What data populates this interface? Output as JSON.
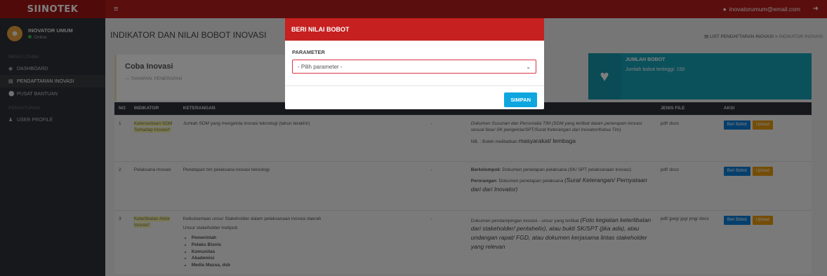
{
  "topbar": {
    "brand": "SIINOTEK",
    "hamburger_icon": "≡",
    "user_email": "inovatorumum@email.com",
    "logout_icon": "➜"
  },
  "sidebar": {
    "user_name": "INOVATOR UMUM",
    "user_status": "Online",
    "header_main": "MENU UTAMA",
    "items": [
      {
        "label": "DASHBOARD",
        "icon": "dashboard-icon"
      },
      {
        "label": "PENDAFTARAN INOVASI",
        "icon": "list-icon"
      },
      {
        "label": "PUSAT BANTUAN",
        "icon": "help-icon"
      }
    ],
    "header_settings": "PENGATURAN",
    "settings_items": [
      {
        "label": "USER PROFILE",
        "icon": "user-icon"
      }
    ]
  },
  "main": {
    "page_title": "INDIKATOR DAN NILAI BOBOT INOVASI",
    "breadcrumb_link": "LIST PENDAFTARAN INOVASI",
    "breadcrumb_sep": ">",
    "breadcrumb_current": "INDIKATOR INOVASI",
    "card_title": "Coba Inovasi",
    "card_sub": "— TAHAPAN: PENERAPAN",
    "info_label": "JUMLAH BOBOT",
    "info_value": "Jumlah bobot tertinggi: 150"
  },
  "table": {
    "headers": [
      "NO",
      "INDIKATOR",
      "KETERANGAN",
      "",
      "",
      "JENIS FILE",
      "AKSI"
    ],
    "rows": [
      {
        "no": "1",
        "indikator": "Ketersediaan SDM Terhadap Inovasi*",
        "keterangan": "Jumlah SDM yang mengelola inovasi teknologi (tahun terakhir)",
        "nilai": "-",
        "bukti": "Dokumen Susunan dan Personalia TIM (SDM yang terlibat dalam penerapan inovasi sesuai fase/ SK pengelola/SPT/Surat Keterangan dari Inovator/Ketua Tim)",
        "bukti_note_prefix": "NB. : Boleh melibatkan",
        "bukti_note_big": "masyarakat/ lembaga",
        "jenis_file": "pdf/ docx",
        "btn_nilai": "Beri Bobot",
        "btn_upload": "Upload"
      },
      {
        "no": "2",
        "indikator": "Pelaksana Inovasi",
        "keterangan": "Penetapan tim pelaksana inovasi teknologi",
        "nilai": "-",
        "bukti_a_label": "Berkelompok",
        "bukti_a": ": Dokumen penetapan pelaksana (SK/ SPT pelaksanaan inovasi)",
        "bukti_b_label": "Perorangan",
        "bukti_b": ": Dokumen penetapan pelaksana",
        "bukti_b_big": "(Surat Keterangan/ Pernyataan dari dari Inovator)",
        "jenis_file": "pdf/ docx",
        "btn_nilai": "Beri Bobot",
        "btn_upload": "Upload"
      },
      {
        "no": "3",
        "indikator": "Keterlibatan Aktor Inovasi*",
        "keterangan": "Keikutsertaan unsur Stakeholder dalam pelaksanaan inovasi daerah",
        "keterangan_sub": "Unsur stakeholder meliputi:",
        "list": [
          "Pemerintah",
          "Pelaku Bisnis",
          "Komunitas",
          "Akademisi",
          "Media Massa, dsb"
        ],
        "nilai": "-",
        "bukti_prefix": "Dokumen pendampingan inovasi - unsur yang terlibat",
        "bukti_big": "(Foto kegiatan keterlibatan dari stakeholder/ pentahelix), atau bukti SK/SPT (jika ada), atau undangan rapat/ FGD, atau dokumen kerjasama lintas stakeholder yang relevan",
        "jenis_file": "pdf/ jpeg/ jpg/ png/ docx",
        "btn_nilai": "Beri Bobot",
        "btn_upload": "Upload"
      }
    ]
  },
  "modal": {
    "title": "BERI NILAI BOBOT",
    "param_label": "PARAMETER",
    "select_value": "- Pilih parameter -",
    "save_label": "SIMPAN"
  }
}
